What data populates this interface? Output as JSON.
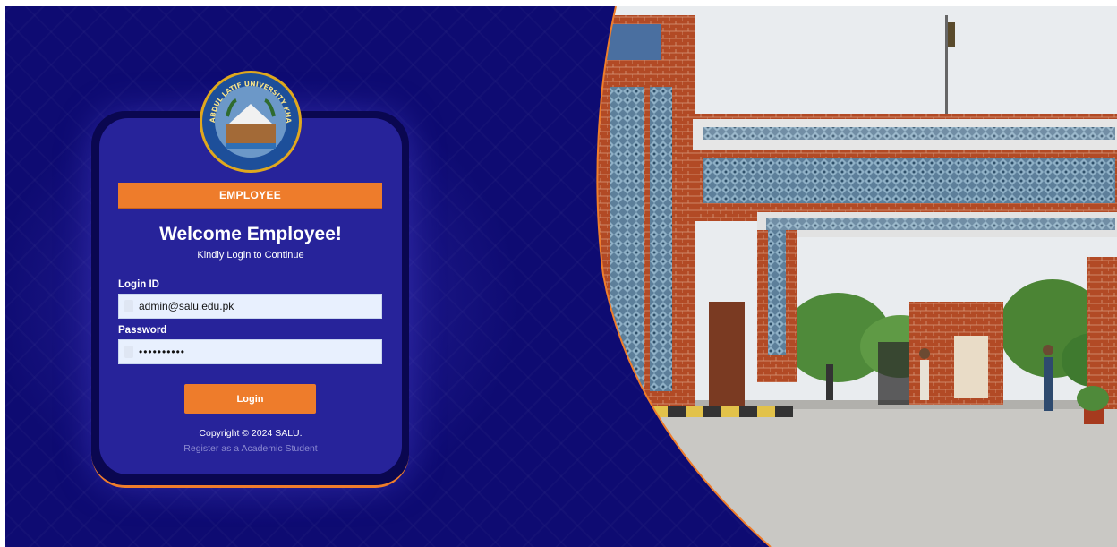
{
  "login_card": {
    "role_tab_label": "EMPLOYEE",
    "welcome_title": "Welcome Employee!",
    "subtitle": "Kindly Login to Continue",
    "login_id_label": "Login ID",
    "login_id_value": "admin@salu.edu.pk",
    "password_label": "Password",
    "password_value": "••••••••••",
    "login_button_label": "Login",
    "copyright": "Copyright © 2024 SALU.",
    "register_link": "Register as a Academic Student"
  },
  "logo": {
    "text": "SHAH ABDUL LATIF UNIVERSITY KHAIRPUR",
    "icon": "university-seal-icon"
  },
  "colors": {
    "background_navy": "#0e0b72",
    "card_blue": "#27239a",
    "accent_orange": "#ee7c2b",
    "input_fill": "#e8f0fe"
  }
}
